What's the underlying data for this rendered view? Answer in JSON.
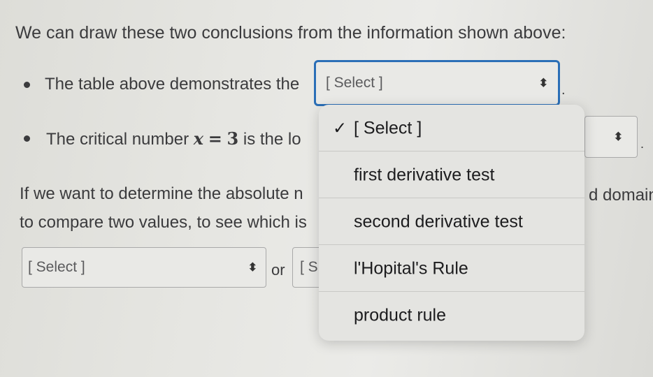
{
  "intro": "We can draw these two conclusions from the information shown above:",
  "bullet1": {
    "text": "The table above demonstrates the",
    "select_value": "[ Select ]",
    "after": "."
  },
  "bullet2": {
    "text_before": "The critical number",
    "var": "x",
    "eq": "=",
    "num": "3",
    "text_after": "is the lo",
    "after": "."
  },
  "para": {
    "line1_left": "If we want to determine the absolute n",
    "line1_right": "d domain",
    "line2_left": "to compare two values, to see which is"
  },
  "bottom": {
    "select1_value": "[ Select ]",
    "or": "or",
    "select2_partial": "[ S"
  },
  "dropdown": {
    "options": [
      {
        "label": "[ Select ]",
        "checked": true
      },
      {
        "label": "first derivative test",
        "checked": false
      },
      {
        "label": "second derivative test",
        "checked": false
      },
      {
        "label": "l'Hopital's Rule",
        "checked": false
      },
      {
        "label": "product rule",
        "checked": false
      }
    ],
    "check_glyph": "✓"
  },
  "icons": {
    "chevron": "up-down-chevron-icon"
  }
}
